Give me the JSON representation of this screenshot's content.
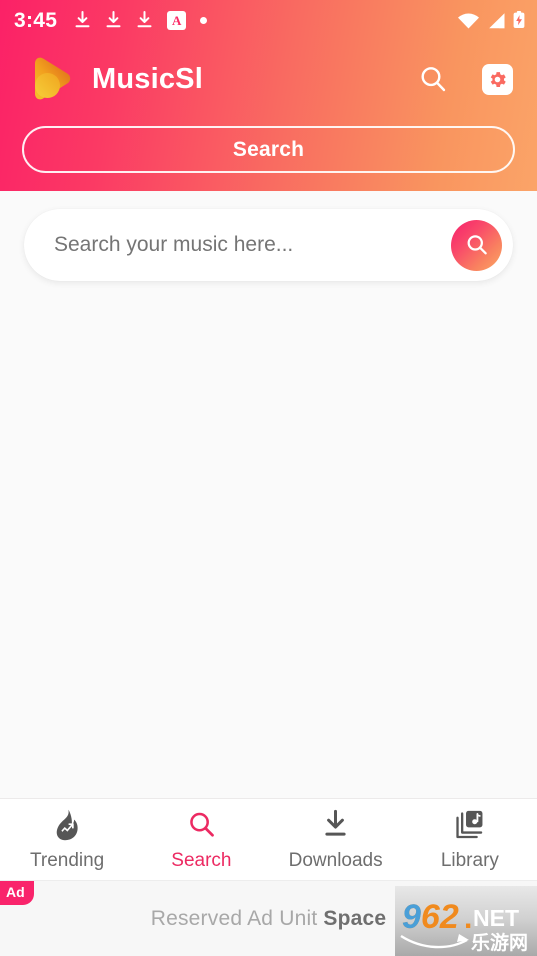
{
  "statusbar": {
    "time": "3:45",
    "left_icons": [
      "download-icon",
      "download-icon",
      "download-icon",
      "translate-icon",
      "dot-icon"
    ],
    "translate_letter": "A",
    "right_icons": [
      "wifi-icon",
      "cellular-signal-icon",
      "battery-charging-icon"
    ]
  },
  "header": {
    "brand_title": "MusicSl",
    "logo_icon": "music-play-logo",
    "search_icon": "search-icon",
    "settings_icon": "gear-icon",
    "gradient_start": "#fb2167",
    "gradient_end": "#fba468",
    "tab_label": "Search"
  },
  "search": {
    "placeholder": "Search your music here...",
    "value": "",
    "submit_icon": "search-icon"
  },
  "bottom_nav": {
    "active_color": "#ec2a62",
    "inactive_color": "#6e6e6e",
    "items": [
      {
        "label": "Trending",
        "icon": "flame-trending-icon",
        "active": false
      },
      {
        "label": "Search",
        "icon": "search-icon",
        "active": true
      },
      {
        "label": "Downloads",
        "icon": "download-icon",
        "active": false
      },
      {
        "label": "Library",
        "icon": "music-library-icon",
        "active": false
      }
    ]
  },
  "ad": {
    "badge": "Ad",
    "text_plain": "Reserved Ad Unit ",
    "text_bold": "Space",
    "watermark": {
      "number": "962",
      "domain": ".NET",
      "subtitle": "乐游网"
    }
  }
}
